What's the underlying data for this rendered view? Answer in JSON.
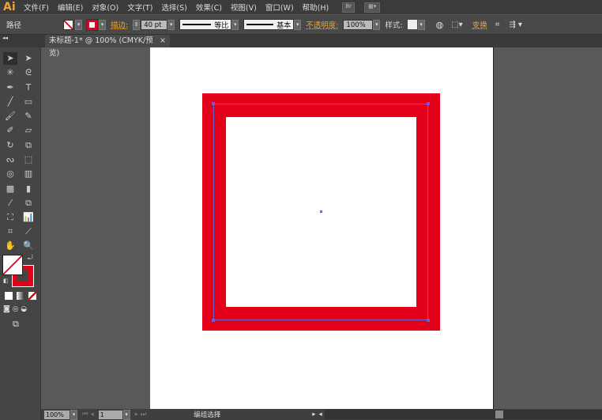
{
  "app": {
    "logo": "Ai"
  },
  "menu": [
    "文件(F)",
    "编辑(E)",
    "对象(O)",
    "文字(T)",
    "选择(S)",
    "效果(C)",
    "视图(V)",
    "窗口(W)",
    "帮助(H)"
  ],
  "menu_buttons": {
    "bridge": "Br"
  },
  "control": {
    "selection_type": "路径",
    "stroke_label": "描边:",
    "stroke_weight": "40 pt",
    "profile": "等比",
    "brush": "基本",
    "opacity_label": "不透明度:",
    "opacity": "100%",
    "style_label": "样式:",
    "transform_label": "变换"
  },
  "document": {
    "tab_title": "未标题-1* @ 100% (CMYK/预览)",
    "close": "×"
  },
  "colors": {
    "fill": "none",
    "stroke": "#e2001a",
    "path_stroke_weight_pt": 40
  },
  "tools": [
    "selection",
    "direct-selection",
    "magic-wand",
    "lasso",
    "pen",
    "type",
    "line",
    "rectangle",
    "paintbrush",
    "pencil",
    "blob-brush",
    "eraser",
    "rotate",
    "scale",
    "warp",
    "free-transform",
    "shape-builder",
    "perspective-grid",
    "mesh",
    "gradient",
    "eyedropper",
    "blend",
    "symbol-sprayer",
    "column-graph",
    "artboard",
    "slice",
    "hand",
    "zoom"
  ],
  "status": {
    "zoom": "100%",
    "page": "1",
    "mode": "编组选择"
  }
}
